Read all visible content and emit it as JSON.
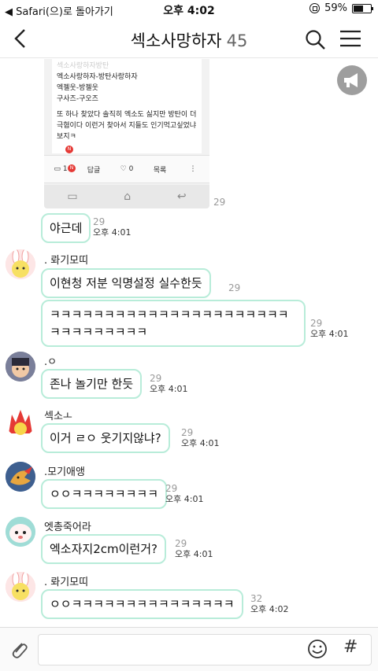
{
  "status_bar": {
    "back_app": "◀ Safari(으)로 돌아가기",
    "time": "오후 4:02",
    "battery_percent": "59%",
    "battery_level": 0.59
  },
  "header": {
    "title": "섹소사망하자",
    "member_count": "45"
  },
  "shared_image": {
    "lines": [
      "엑소사랑하자-방탄사랑하자",
      "엑젤웃-방젤웃",
      "구사즈-구오즈",
      "또 하나 찾았다 솔직히 엑소도 싫지만 방탄이 더",
      "극혐이다 이런거 찾아서 지들도 인기먹고싶었냐",
      "보지ㅋ"
    ],
    "faint_line": "섹소사랑하자방탄",
    "bar_items": [
      "1",
      "답글",
      "0",
      "목록",
      "⋮"
    ],
    "badge": "N",
    "unread": "29"
  },
  "messages": [
    {
      "sender": "",
      "text": "야근데",
      "unread": "29",
      "time": "오후 4:01"
    },
    {
      "sender": ". 롸기모띠",
      "text": "이현청 저분 익명설정 실수한듯",
      "unread": "29",
      "time": ""
    },
    {
      "sender": "",
      "text": "ㅋㅋㅋㅋㅋㅋㅋㅋㅋㅋㅋㅋㅋㅋㅋㅋㅋㅋㅋㅋㅋㅋㅋㅋㅋㅋㅋㅋㅋㅋㅋ",
      "unread": "29",
      "time": "오후 4:01"
    },
    {
      "sender": ".ㅇ",
      "text": "존나 놀기만 한듯",
      "unread": "29",
      "time": "오후 4:01"
    },
    {
      "sender": "섹소ㅗ",
      "text": "이거 ㄹㅇ 웃기지않냐?",
      "unread": "29",
      "time": "오후 4:01"
    },
    {
      "sender": ".모기애앵",
      "text": "ㅇㅇㅋㅋㅋㅋㅋㅋㅋㅋ",
      "unread": "29",
      "time": "오후 4:01"
    },
    {
      "sender": "엣총죽어라",
      "text": "엑소자지2cm이런거?",
      "unread": "29",
      "time": "오후 4:01"
    },
    {
      "sender": ". 롸기모띠",
      "text": "ㅇㅇㅋㅋㅋㅋㅋㅋㅋㅋㅋㅋㅋㅋㅋㅋㅋ",
      "unread": "32",
      "time": "오후 4:02"
    }
  ],
  "icons": {
    "back": "back-arrow-icon",
    "search": "search-icon",
    "menu": "hamburger-menu-icon",
    "notice": "megaphone-icon",
    "attach": "paperclip-icon",
    "emoji": "emoji-icon",
    "hashtag": "hashtag-icon"
  },
  "colors": {
    "bubble_border": "#b8ecd9",
    "badge": "#e53935"
  }
}
